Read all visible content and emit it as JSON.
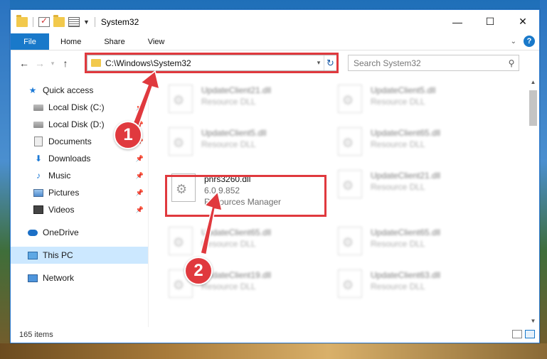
{
  "window": {
    "title": "System32",
    "controls": {
      "minimize": "—",
      "maximize": "☐",
      "close": "✕"
    }
  },
  "ribbon": {
    "tabs": [
      "File",
      "Home",
      "Share",
      "View"
    ]
  },
  "navbar": {
    "address_path": "C:\\Windows\\System32",
    "search_placeholder": "Search System32"
  },
  "sidebar": {
    "items": [
      {
        "label": "Quick access",
        "icon": "star-icon",
        "pinned": false
      },
      {
        "label": "Local Disk (C:)",
        "icon": "disk-icon",
        "pinned": true
      },
      {
        "label": "Local Disk (D:)",
        "icon": "disk-icon",
        "pinned": true
      },
      {
        "label": "Documents",
        "icon": "documents-icon",
        "pinned": true
      },
      {
        "label": "Downloads",
        "icon": "download-icon",
        "pinned": true
      },
      {
        "label": "Music",
        "icon": "music-icon",
        "pinned": true
      },
      {
        "label": "Pictures",
        "icon": "pictures-icon",
        "pinned": true
      },
      {
        "label": "Videos",
        "icon": "videos-icon",
        "pinned": true
      },
      {
        "label": "OneDrive",
        "icon": "onedrive-icon",
        "pinned": false
      },
      {
        "label": "This PC",
        "icon": "this-pc-icon",
        "pinned": false,
        "selected": true
      },
      {
        "label": "Network",
        "icon": "network-icon",
        "pinned": false
      }
    ]
  },
  "files": {
    "highlighted": {
      "name": "pnrs3260.dll",
      "version": "6.0.9.852",
      "description": "Resources Manager"
    },
    "blurred": [
      {
        "name": "UpdateClient21.dll",
        "description": "Resource DLL"
      },
      {
        "name": "UpdateClient5.dll",
        "description": "Resource DLL"
      },
      {
        "name": "UpdateClient5.dll",
        "description": "Resource DLL"
      },
      {
        "name": "UpdateClient65.dll",
        "description": "Resource DLL"
      },
      {
        "name": "UpdateClient21.dll",
        "description": "Resource DLL"
      },
      {
        "name": "UpdateClient65.dll",
        "description": "Resource DLL"
      },
      {
        "name": "UpdateClient65.dll",
        "description": "Resource DLL"
      },
      {
        "name": "UpdateClient19.dll",
        "description": "Resource DLL"
      },
      {
        "name": "UpdateClient63.dll",
        "description": "Resource DLL"
      }
    ]
  },
  "status": {
    "item_count": "165 items"
  },
  "callouts": {
    "step1": "1",
    "step2": "2"
  },
  "colors": {
    "accent": "#1979ca",
    "highlight": "#e0393e",
    "selection": "#cce8ff"
  }
}
